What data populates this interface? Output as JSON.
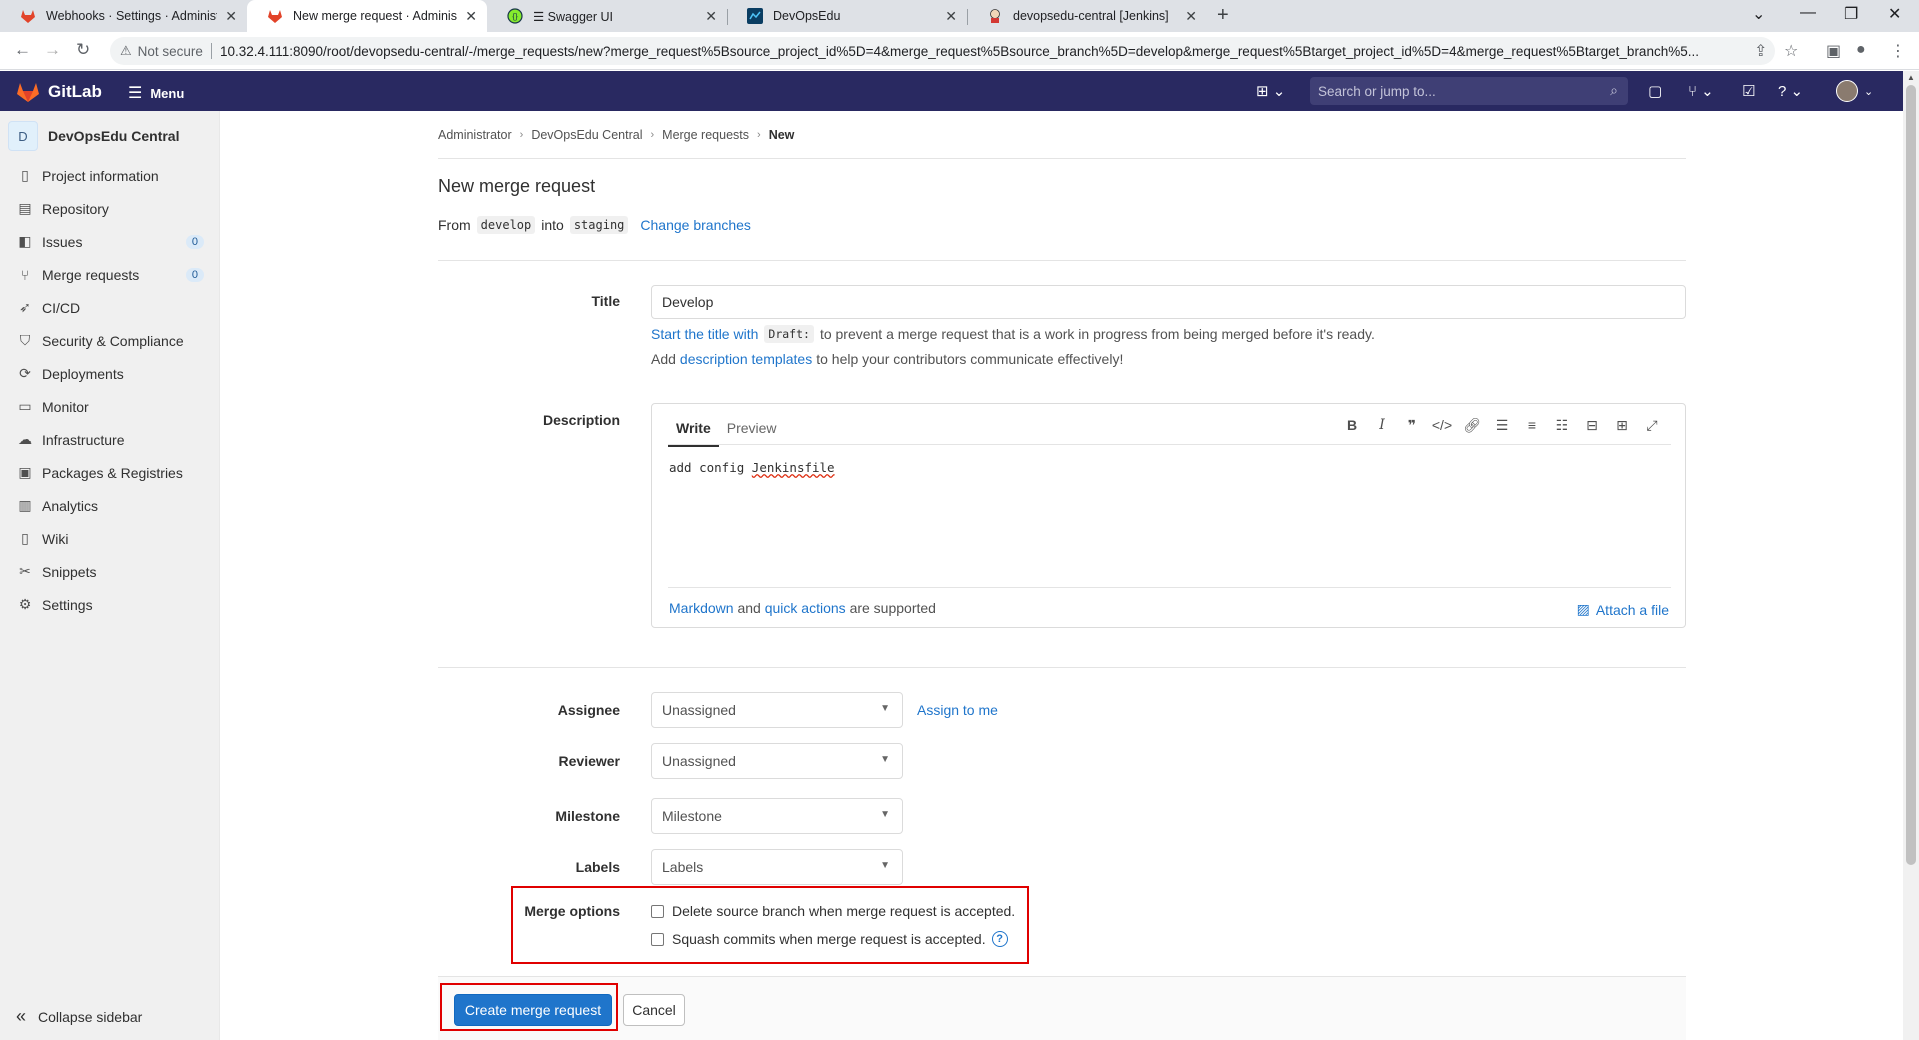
{
  "browser": {
    "tabs": [
      {
        "title": "Webhooks · Settings · Administra",
        "icon": "gitlab-icon"
      },
      {
        "title": "New merge request · Administrat",
        "icon": "gitlab-icon"
      },
      {
        "title": "☰ Swagger UI",
        "icon": "swagger-icon"
      },
      {
        "title": "DevOpsEdu",
        "icon": "chart-icon"
      },
      {
        "title": "devopsedu-central [Jenkins]",
        "icon": "jenkins-icon"
      }
    ],
    "not_secure": "Not secure",
    "url": "10.32.4.111:8090/root/devopsedu-central/-/merge_requests/new?merge_request%5Bsource_project_id%5D=4&merge_request%5Bsource_branch%5D=develop&merge_request%5Btarget_project_id%5D=4&merge_request%5Btarget_branch%5..."
  },
  "header": {
    "brand": "GitLab",
    "menu_label": "Menu",
    "search_placeholder": "Search or jump to...",
    "brand_color": "#292961"
  },
  "sidebar": {
    "project_initial": "D",
    "project_name": "DevOpsEdu Central",
    "items": [
      {
        "label": "Project information",
        "icon": "info-icon"
      },
      {
        "label": "Repository",
        "icon": "doc-icon"
      },
      {
        "label": "Issues",
        "icon": "issues-icon",
        "count": "0"
      },
      {
        "label": "Merge requests",
        "icon": "merge-icon",
        "count": "0"
      },
      {
        "label": "CI/CD",
        "icon": "rocket-icon"
      },
      {
        "label": "Security & Compliance",
        "icon": "shield-icon"
      },
      {
        "label": "Deployments",
        "icon": "deploy-icon"
      },
      {
        "label": "Monitor",
        "icon": "monitor-icon"
      },
      {
        "label": "Infrastructure",
        "icon": "cloud-icon"
      },
      {
        "label": "Packages & Registries",
        "icon": "package-icon"
      },
      {
        "label": "Analytics",
        "icon": "chart-icon"
      },
      {
        "label": "Wiki",
        "icon": "book-icon"
      },
      {
        "label": "Snippets",
        "icon": "scissors-icon"
      },
      {
        "label": "Settings",
        "icon": "gear-icon"
      }
    ],
    "collapse_label": "Collapse sidebar"
  },
  "breadcrumb": [
    "Administrator",
    "DevOpsEdu Central",
    "Merge requests",
    "New"
  ],
  "page": {
    "title": "New merge request",
    "from_label": "From",
    "source_branch": "develop",
    "into_label": "into",
    "target_branch": "staging",
    "change_branches": "Change branches"
  },
  "form": {
    "title_label": "Title",
    "title_value": "Develop",
    "hint1_link": "Start the title with",
    "hint1_code": "Draft:",
    "hint1_rest": "to prevent a merge request that is a work in progress from being merged before it's ready.",
    "hint2_pre": "Add",
    "hint2_link": "description templates",
    "hint2_rest": "to help your contributors communicate effectively!",
    "description_label": "Description",
    "write_tab": "Write",
    "preview_tab": "Preview",
    "description_pre": "add config ",
    "description_word": "Jenkinsfile",
    "markdown_link": "Markdown",
    "and": "and",
    "quick_actions_link": "quick actions",
    "supported": "are supported",
    "attach_file": "Attach a file",
    "assignee_label": "Assignee",
    "assignee_value": "Unassigned",
    "assign_to_me": "Assign to me",
    "reviewer_label": "Reviewer",
    "reviewer_value": "Unassigned",
    "milestone_label": "Milestone",
    "milestone_value": "Milestone",
    "labels_label": "Labels",
    "labels_value": "Labels",
    "merge_options_label": "Merge options",
    "delete_source": "Delete source branch when merge request is accepted.",
    "squash": "Squash commits when merge request is accepted.",
    "create_button": "Create merge request",
    "cancel_button": "Cancel"
  }
}
